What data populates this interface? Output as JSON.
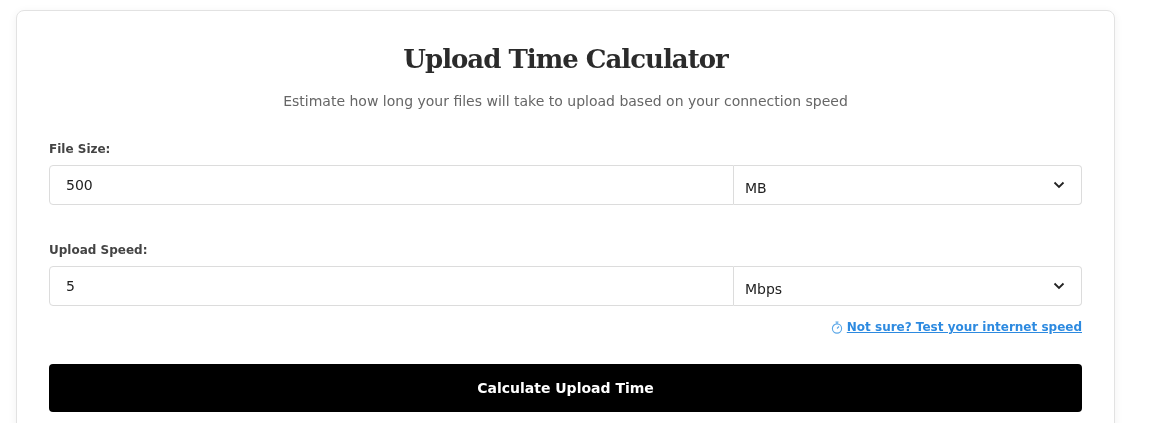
{
  "title": "Upload Time Calculator",
  "subtitle": "Estimate how long your files will take to upload based on your connection speed",
  "fields": [
    {
      "label": "File Size:",
      "value": "500",
      "unit": "MB"
    },
    {
      "label": "Upload Speed:",
      "value": "5",
      "unit": "Mbps"
    }
  ],
  "speed_test_link": "Not sure? Test your internet speed",
  "calculate_button": "Calculate Upload Time"
}
